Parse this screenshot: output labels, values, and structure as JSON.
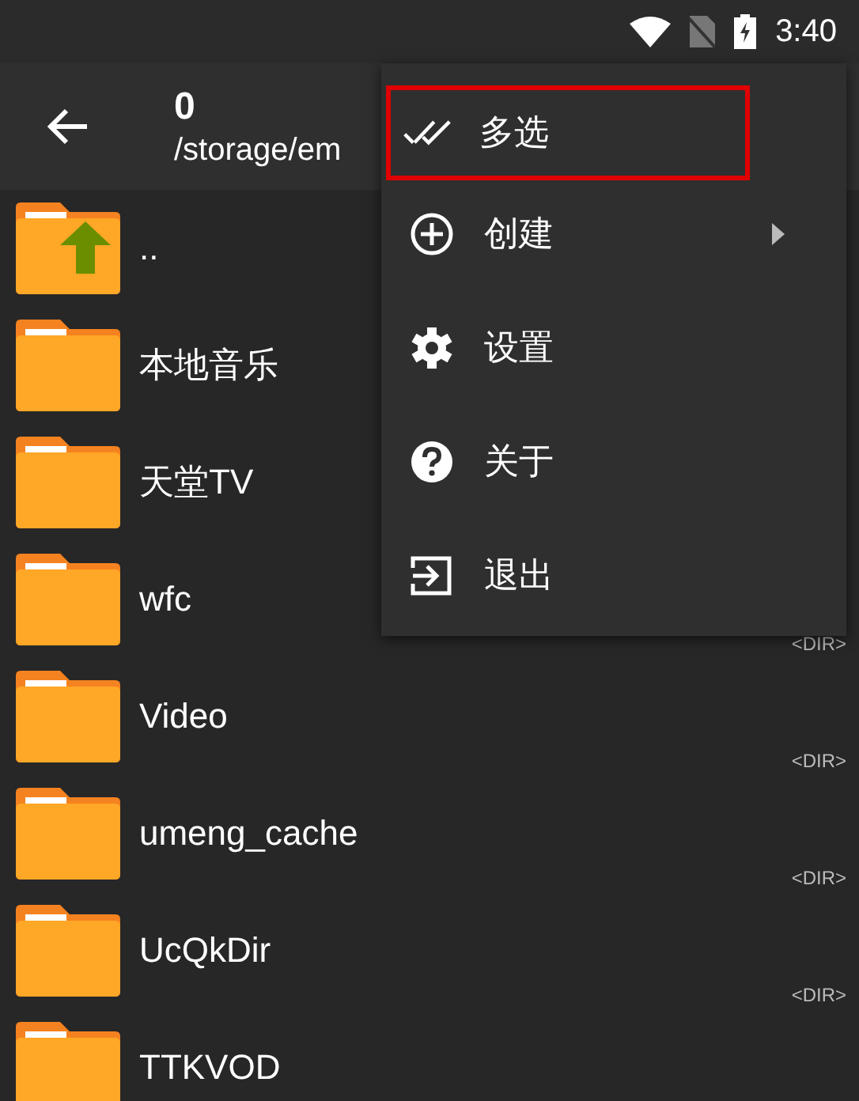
{
  "status_bar": {
    "time": "3:40"
  },
  "toolbar": {
    "title": "0",
    "path": "/storage/em"
  },
  "files": [
    {
      "name": "..",
      "kind": "parent"
    },
    {
      "name": "本地音乐",
      "kind": "folder"
    },
    {
      "name": "天堂TV",
      "kind": "folder"
    },
    {
      "name": "wfc",
      "kind": "folder",
      "info": "<DIR>"
    },
    {
      "name": "Video",
      "kind": "folder",
      "info": "<DIR>"
    },
    {
      "name": "umeng_cache",
      "kind": "folder",
      "info": "<DIR>"
    },
    {
      "name": "UcQkDir",
      "kind": "folder",
      "info": "<DIR>"
    },
    {
      "name": "TTKVOD",
      "kind": "folder"
    }
  ],
  "menu": [
    {
      "label": "多选",
      "kind": "multiselect",
      "submenu": false,
      "highlighted": true
    },
    {
      "label": "创建",
      "kind": "create",
      "submenu": true,
      "highlighted": false
    },
    {
      "label": "设置",
      "kind": "settings",
      "submenu": false,
      "highlighted": false
    },
    {
      "label": "关于",
      "kind": "about",
      "submenu": false,
      "highlighted": false
    },
    {
      "label": "退出",
      "kind": "exit",
      "submenu": false,
      "highlighted": false
    }
  ]
}
